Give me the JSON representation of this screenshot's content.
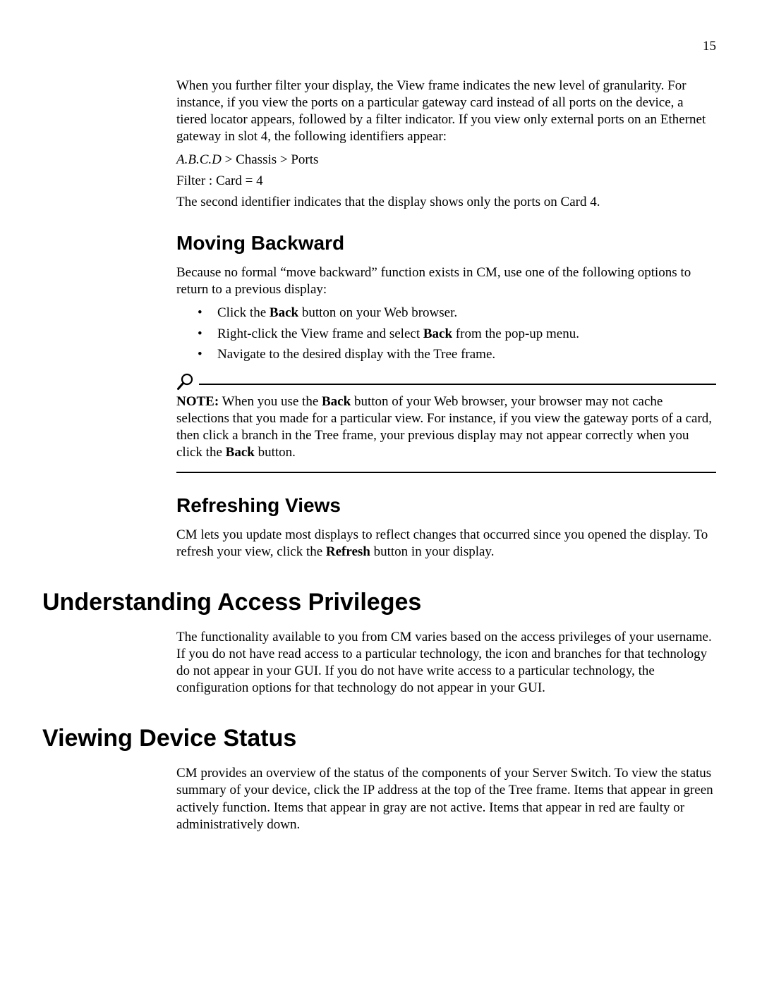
{
  "page_number": "15",
  "intro": {
    "p1": "When you further filter your display, the View frame indicates the new level of granularity. For instance, if you view the ports on a particular gateway card instead of all ports on the device, a tiered locator appears, followed by a filter indicator. If you view only external ports on an Ethernet gateway in slot 4, the following identifiers appear:",
    "locator_italic": "A.B.C.D",
    "locator_rest": " > Chassis > Ports",
    "filter_line": "Filter : Card = 4",
    "p2": "The second identifier indicates that the display shows only the ports on Card 4."
  },
  "moving_backward": {
    "heading": "Moving Backward",
    "intro": "Because no formal “move backward” function exists in CM, use one of the following options to return to a previous display:",
    "bullets": {
      "b1_pre": "Click the ",
      "b1_bold": "Back",
      "b1_post": " button on your Web browser.",
      "b2_pre": "Right-click the View frame and select ",
      "b2_bold": "Back",
      "b2_post": " from the pop-up menu.",
      "b3": "Navigate to the desired display with the Tree frame."
    },
    "note": {
      "label": "NOTE:",
      "seg1": "  When you use the ",
      "bold1": "Back",
      "seg2": " button of your Web browser, your browser may not cache selections that you made for a particular view. For instance, if you view the gateway ports of a card, then click a branch in the Tree frame, your previous display may not appear correctly when you click the ",
      "bold2": "Back",
      "seg3": " button."
    }
  },
  "refreshing_views": {
    "heading": "Refreshing Views",
    "p_pre": "CM lets you update most displays to reflect changes that occurred since you opened the display. To refresh your view, click the ",
    "p_bold": "Refresh",
    "p_post": " button in your display."
  },
  "access_privileges": {
    "heading": "Understanding Access Privileges",
    "p": "The functionality available to you from CM varies based on the access privileges of your username. If you do not have read access to a particular technology, the icon and branches for that technology do not appear in your GUI. If you do not have write access to a particular technology, the configuration options for that technology do not appear in your GUI."
  },
  "device_status": {
    "heading": "Viewing Device Status",
    "p": "CM provides an overview of the status of the components of your Server Switch. To view the status summary of your device, click the IP address at the top of the Tree frame. Items that appear in green actively function. Items that appear in gray are not active. Items that appear in red are faulty or administratively down."
  }
}
